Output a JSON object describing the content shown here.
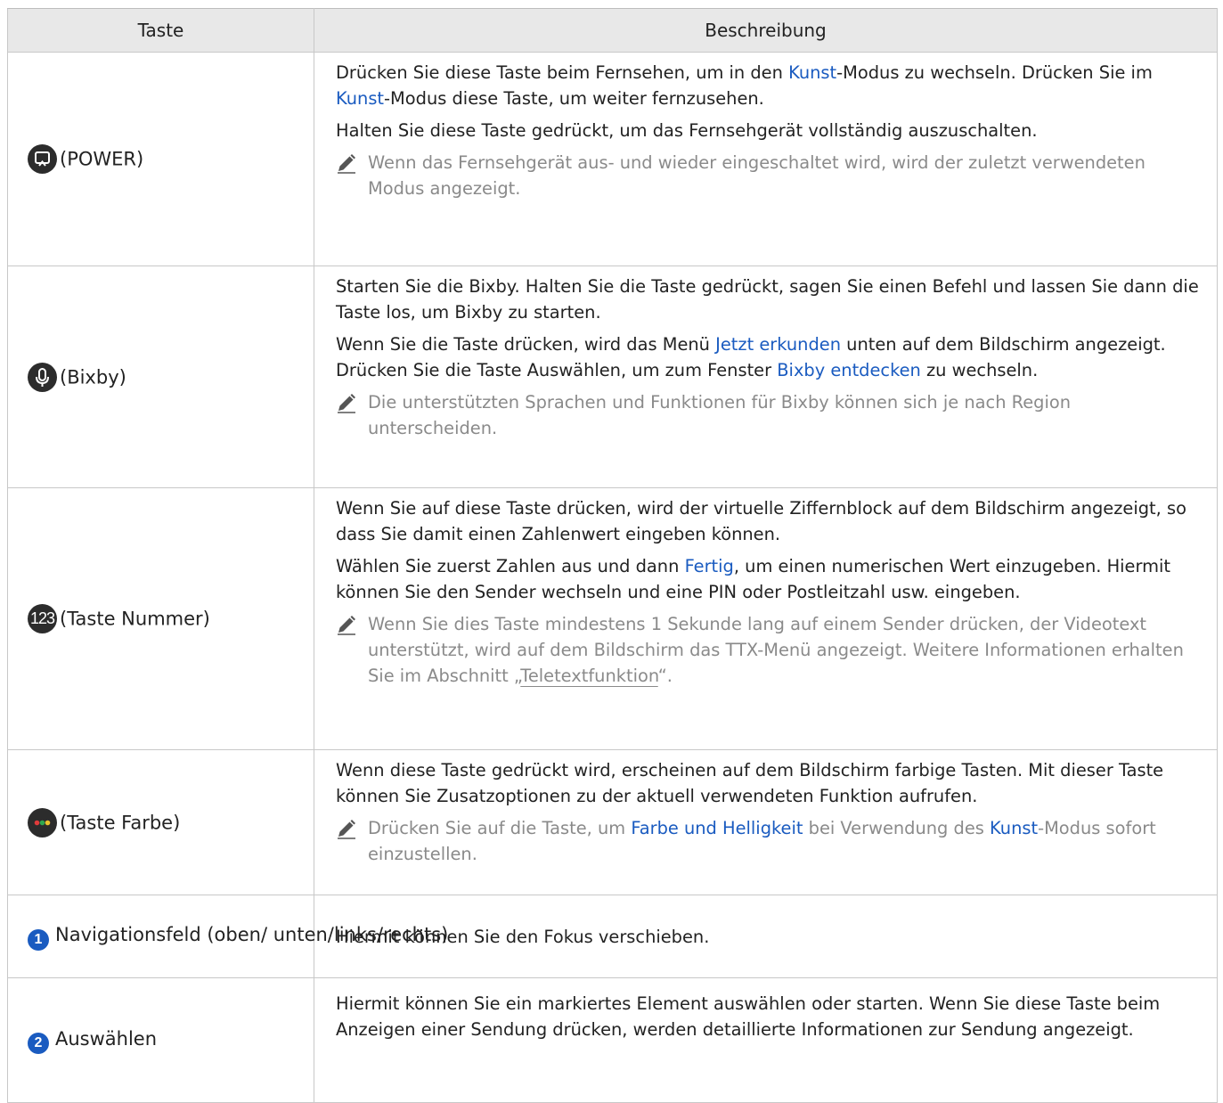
{
  "header": {
    "col_key": "Taste",
    "col_desc": "Beschreibung"
  },
  "rows": {
    "power": {
      "key_label": "(POWER)",
      "p1": [
        "Drücken Sie diese Taste beim Fernsehen, um in den ",
        "Kunst",
        "-Modus zu wechseln. Drücken Sie im ",
        "Kunst",
        "-Modus diese Taste, um weiter fernzusehen."
      ],
      "p2": "Halten Sie diese Taste gedrückt, um das Fernsehgerät vollständig auszuschalten.",
      "note": "Wenn das Fernsehgerät aus- und wieder eingeschaltet wird, wird der zuletzt verwendeten Modus angezeigt."
    },
    "bixby": {
      "key_label": "(Bixby)",
      "p1": "Starten Sie die Bixby. Halten Sie die Taste gedrückt, sagen Sie einen Befehl und lassen Sie dann die Taste los, um Bixby zu starten.",
      "p2": [
        "Wenn Sie die Taste drücken, wird das Menü ",
        "Jetzt erkunden",
        " unten auf dem Bildschirm angezeigt. Drücken Sie die Taste Auswählen, um zum Fenster ",
        "Bixby entdecken",
        " zu wechseln."
      ],
      "note": "Die unterstützten Sprachen und Funktionen für Bixby können sich je nach Region unterscheiden."
    },
    "number": {
      "icon_text": "123",
      "key_label": "(Taste Nummer)",
      "p1": "Wenn Sie auf diese Taste drücken, wird der virtuelle Ziffernblock auf dem Bildschirm angezeigt, so dass Sie damit einen Zahlenwert eingeben können.",
      "p2": [
        "Wählen Sie zuerst Zahlen aus und dann ",
        "Fertig",
        ", um einen numerischen Wert einzugeben. Hiermit können Sie den Sender wechseln und eine PIN oder Postleitzahl usw. eingeben."
      ],
      "note": [
        "Wenn Sie dies Taste mindestens 1 Sekunde lang auf einem Sender drücken, der Videotext unterstützt, wird auf dem Bildschirm das TTX-Menü angezeigt. Weitere Informationen erhalten Sie im Abschnitt „",
        "Teletextfunktion",
        "“."
      ]
    },
    "color": {
      "key_label": "(Taste Farbe)",
      "p1": "Wenn diese Taste gedrückt wird, erscheinen auf dem Bildschirm farbige Tasten. Mit dieser Taste können Sie Zusatzoptionen zu der aktuell verwendeten Funktion aufrufen.",
      "note": [
        "Drücken Sie auf die Taste, um ",
        "Farbe und Helligkeit",
        " bei Verwendung des ",
        "Kunst",
        "-Modus sofort einzustellen."
      ]
    },
    "nav": {
      "num": "1",
      "key_label": "Navigationsfeld (oben/ unten/links/rechts)",
      "p1": "Hiermit können Sie den Fokus verschieben."
    },
    "select": {
      "num": "2",
      "key_label": "Auswählen",
      "p1": "Hiermit können Sie ein markiertes Element auswählen oder starten. Wenn Sie diese Taste beim Anzeigen einer Sendung drücken, werden detaillierte Informationen zur Sendung angezeigt."
    }
  },
  "colors": {
    "accent": "#1a5bc0",
    "note_text": "#8a8a8a",
    "header_bg": "#e8e8e8",
    "dot_red": "#e03b3b",
    "dot_green": "#2fa84f",
    "dot_yellow": "#e8c22c"
  },
  "icons": {
    "power": "art-mode-power-icon",
    "bixby": "microphone-icon",
    "color": "color-dots-icon",
    "note": "pencil-note-icon"
  }
}
